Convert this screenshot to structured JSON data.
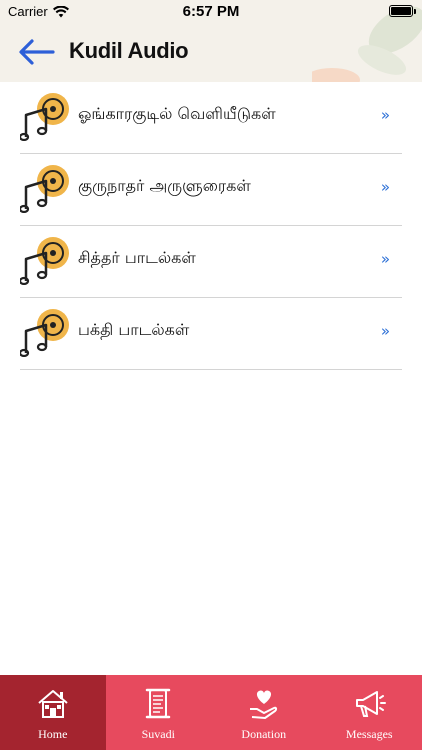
{
  "status_bar": {
    "carrier": "Carrier",
    "time": "6:57 PM"
  },
  "header": {
    "title": "Kudil Audio",
    "back_icon": "arrow-left-icon",
    "accent": "#2d5fd8",
    "background": "#f4f1ea"
  },
  "list": {
    "items": [
      {
        "label": "ஓங்காரகுடில் வெளியீடுகள்",
        "icon": "music-disc-icon",
        "chevron": "»"
      },
      {
        "label": "குருநாதர் அருளுரைகள்",
        "icon": "music-disc-icon",
        "chevron": "»"
      },
      {
        "label": "சித்தர் பாடல்கள்",
        "icon": "music-disc-icon",
        "chevron": "»"
      },
      {
        "label": "பக்தி பாடல்கள்",
        "icon": "music-disc-icon",
        "chevron": "»"
      }
    ]
  },
  "tabbar": {
    "active_color": "#a4242f",
    "color": "#e74a5e",
    "tabs": [
      {
        "label": "Home",
        "icon": "home-icon",
        "active": true
      },
      {
        "label": "Suvadi",
        "icon": "scroll-icon",
        "active": false
      },
      {
        "label": "Donation",
        "icon": "heart-hand-icon",
        "active": false
      },
      {
        "label": "Messages",
        "icon": "megaphone-icon",
        "active": false
      }
    ]
  }
}
